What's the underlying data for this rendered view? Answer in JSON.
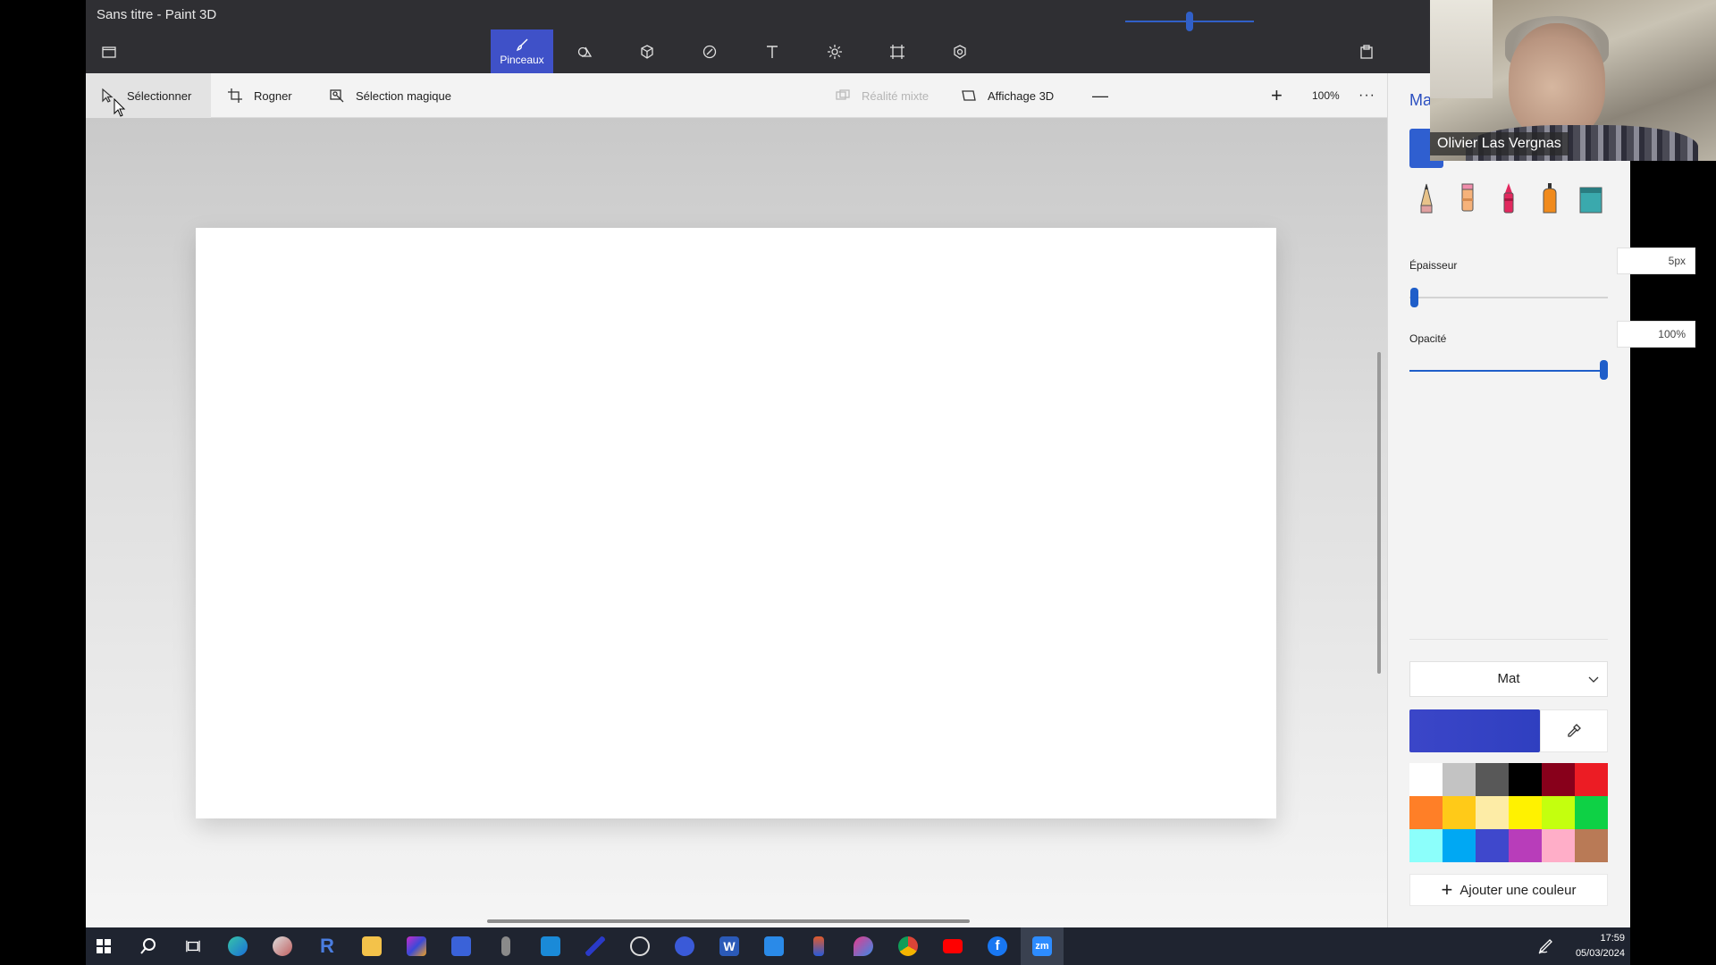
{
  "window": {
    "title": "Sans titre - Paint 3D"
  },
  "toolbar": {
    "brushes_label": "Pinceaux"
  },
  "commandbar": {
    "select_label": "Sélectionner",
    "crop_label": "Rogner",
    "magic_select_label": "Sélection magique",
    "mixed_reality_label": "Réalité mixte",
    "view3d_label": "Affichage 3D",
    "zoom_value": "100%",
    "zoom_percent": 100
  },
  "panel": {
    "title": "Ma",
    "thickness_label": "Épaisseur",
    "thickness_value": "5px",
    "opacity_label": "Opacité",
    "opacity_value": "100%",
    "finish_value": "Mat",
    "current_color": "#3b46c8",
    "add_color_label": "Ajouter une couleur",
    "palette": [
      "#ffffff",
      "#c3c3c3",
      "#585858",
      "#000000",
      "#88001b",
      "#ec1c24",
      "#ff7f27",
      "#ffca18",
      "#fdeca6",
      "#fff200",
      "#c4ff0e",
      "#0ed145",
      "#8cfffb",
      "#00a8f3",
      "#3f48cc",
      "#b83dba",
      "#ffaec8",
      "#b97a56"
    ]
  },
  "webcam": {
    "participant_name": "Olivier Las Vergnas"
  },
  "taskbar": {
    "time": "17:59",
    "date": "05/03/2024"
  },
  "colors": {
    "accent": "#3f51c8",
    "slider": "#1f5ec9"
  }
}
